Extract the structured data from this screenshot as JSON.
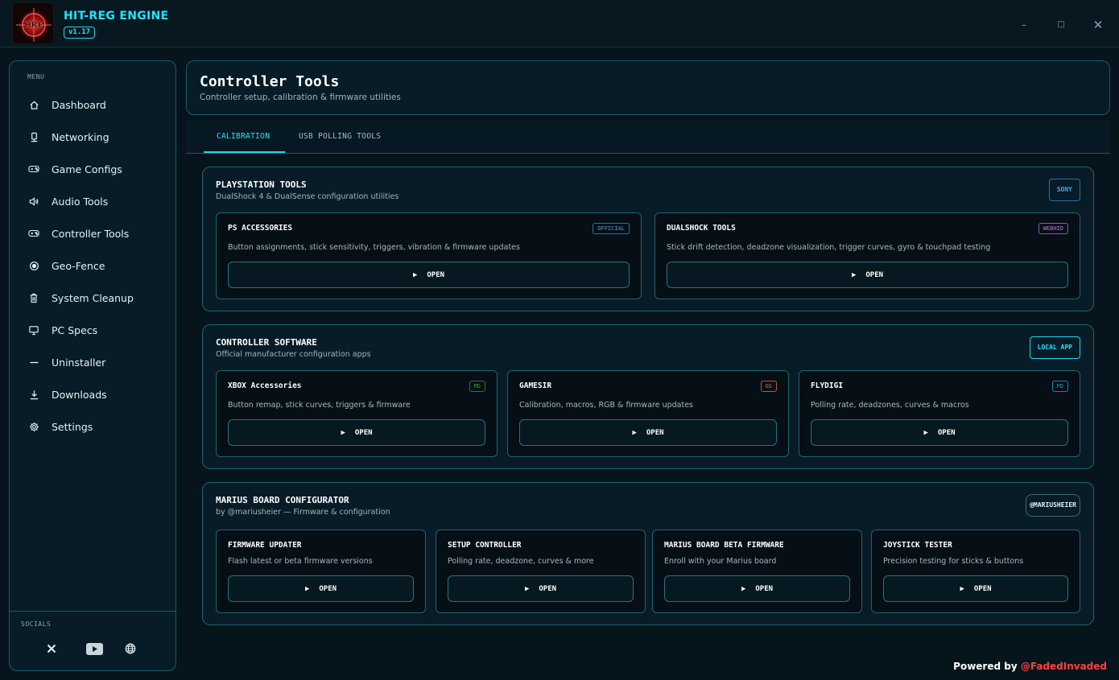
{
  "app": {
    "name": "HIT-REG ENGINE",
    "version": "v1.17",
    "logo_text": "HRE"
  },
  "window_controls": {
    "minimize": "–",
    "maximize": "□",
    "close": "✕"
  },
  "sidebar": {
    "menu_label": "MENU",
    "items": [
      {
        "label": "Dashboard",
        "icon": "home-icon"
      },
      {
        "label": "Networking",
        "icon": "router-icon"
      },
      {
        "label": "Game Configs",
        "icon": "gamepad-icon"
      },
      {
        "label": "Audio Tools",
        "icon": "speaker-icon"
      },
      {
        "label": "Controller Tools",
        "icon": "gamepad-icon",
        "active": true
      },
      {
        "label": "Geo-Fence",
        "icon": "target-icon"
      },
      {
        "label": "System Cleanup",
        "icon": "trash-icon"
      },
      {
        "label": "PC Specs",
        "icon": "monitor-icon"
      },
      {
        "label": "Uninstaller",
        "icon": "minus-icon"
      },
      {
        "label": "Downloads",
        "icon": "download-icon"
      },
      {
        "label": "Settings",
        "icon": "gear-icon"
      }
    ],
    "socials_label": "SOCIALS",
    "socials": [
      "x-icon",
      "youtube-icon",
      "globe-icon"
    ]
  },
  "header": {
    "title": "Controller Tools",
    "subtitle": "Controller setup, calibration & firmware utilities"
  },
  "tabs": [
    {
      "label": "CALIBRATION",
      "active": true
    },
    {
      "label": "USB POLLING TOOLS",
      "active": false
    }
  ],
  "sections": {
    "playstation": {
      "title": "PLAYSTATION TOOLS",
      "subtitle": "DualShock 4 & DualSense configuration utilities",
      "badge": "SONY",
      "cards": [
        {
          "title": "PS ACCESSORIES",
          "badge": "OFFICIAL",
          "desc": "Button assignments, stick sensitivity, triggers, vibration & firmware updates",
          "button": "OPEN"
        },
        {
          "title": "DUALSHOCK TOOLS",
          "badge": "WEBHID",
          "desc": "Stick drift detection, deadzone visualization, trigger curves, gyro & touchpad testing",
          "button": "OPEN"
        }
      ]
    },
    "software": {
      "title": "CONTROLLER SOFTWARE",
      "subtitle": "Official manufacturer configuration apps",
      "badge": "LOCAL APP",
      "cards": [
        {
          "title": "XBOX Accessories",
          "badge": "MS",
          "desc": "Button remap, stick curves, triggers & firmware",
          "button": "OPEN"
        },
        {
          "title": "GAMESIR",
          "badge": "GS",
          "desc": "Calibration, macros, RGB & firmware updates",
          "button": "OPEN"
        },
        {
          "title": "FLYDIGI",
          "badge": "FD",
          "desc": "Polling rate, deadzones, curves & macros",
          "button": "OPEN"
        }
      ]
    },
    "marius": {
      "title": "MARIUS BOARD CONFIGURATOR",
      "subtitle": "by @mariusheier — Firmware & configuration",
      "badge": "@MARIUSHEIER",
      "cards": [
        {
          "title": "FIRMWARE UPDATER",
          "desc": "Flash latest or beta firmware versions",
          "button": "OPEN"
        },
        {
          "title": "SETUP CONTROLLER",
          "desc": "Polling rate, deadzone, curves & more",
          "button": "OPEN"
        },
        {
          "title": "MARIUS BOARD BETA FIRMWARE",
          "desc": "Enroll with your Marius board",
          "button": "OPEN"
        },
        {
          "title": "JOYSTICK TESTER",
          "desc": "Precision testing for sticks & buttons",
          "button": "OPEN"
        }
      ]
    }
  },
  "footer": {
    "powered_by": "Powered by",
    "handle": "@FadedInvaded"
  },
  "colors": {
    "accent": "#22e4ff",
    "background": "#06141c",
    "panel": "#071c26",
    "border": "#1f6470",
    "badge_official": "#3a8ed8",
    "badge_webhid": "#c070e0",
    "badge_ms": "#3aa83a",
    "badge_gs": "#f07030",
    "badge_fd": "#2aa0d8",
    "footer_handle": "#ff4040"
  }
}
